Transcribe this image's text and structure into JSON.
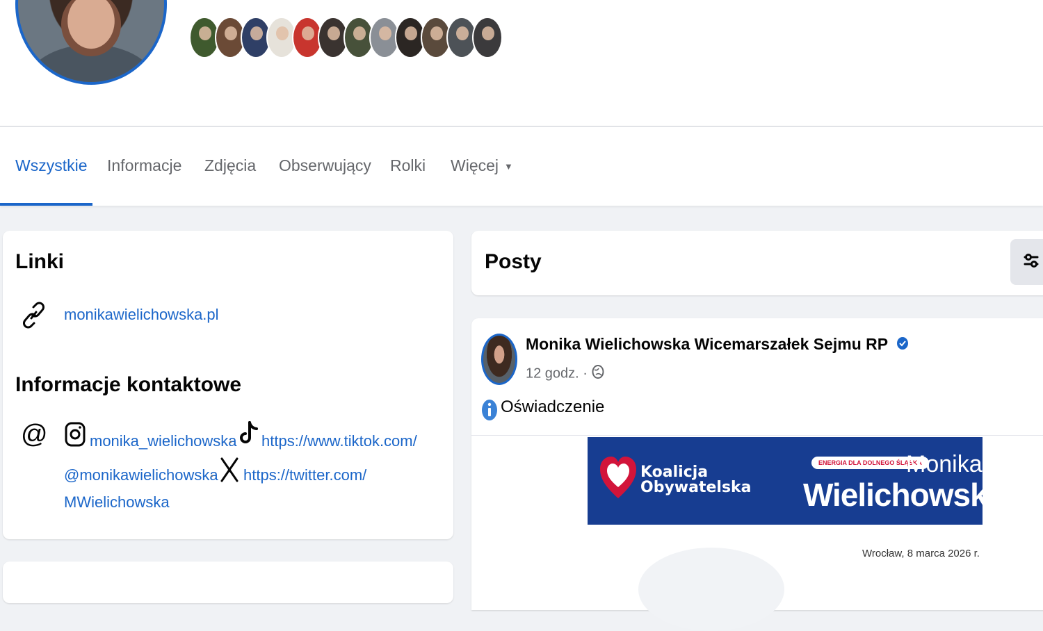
{
  "tabs": {
    "all": "Wszystkie",
    "about": "Informacje",
    "photos": "Zdjęcia",
    "followers": "Obserwujący",
    "reels": "Rolki",
    "more": "Więcej"
  },
  "links_card": {
    "title": "Linki",
    "website": "monikawielichowska.pl",
    "contact_title": "Informacje kontaktowe",
    "instagram": "monika_wielichowska",
    "tiktok_line1": "https://www.tiktok.com/",
    "tiktok_line2": "@monikawielichowska",
    "twitter_line1": "https://twitter.com/",
    "twitter_line2": "MWielichowska",
    "separator": "·"
  },
  "posts": {
    "title": "Posty"
  },
  "post": {
    "author": "Monika Wielichowska Wicemarszałek Sejmu RP",
    "time": "12 godz.",
    "separator": "·",
    "text": "Oświadczenie",
    "banner": {
      "party_line1": "Koalicja",
      "party_line2": "Obywatelska",
      "tag": "ENERGIA DLA DOLNEGO ŚLĄSKA",
      "first_name": "Monika",
      "last_name": "Wielichowska"
    },
    "doc_date": "Wrocław, 8 marca 2026 r."
  },
  "colors": {
    "accent": "#1b66c9",
    "banner": "#173d91",
    "heart": "#d2143a",
    "muted_text": "#65676b",
    "background": "#f0f2f5"
  }
}
